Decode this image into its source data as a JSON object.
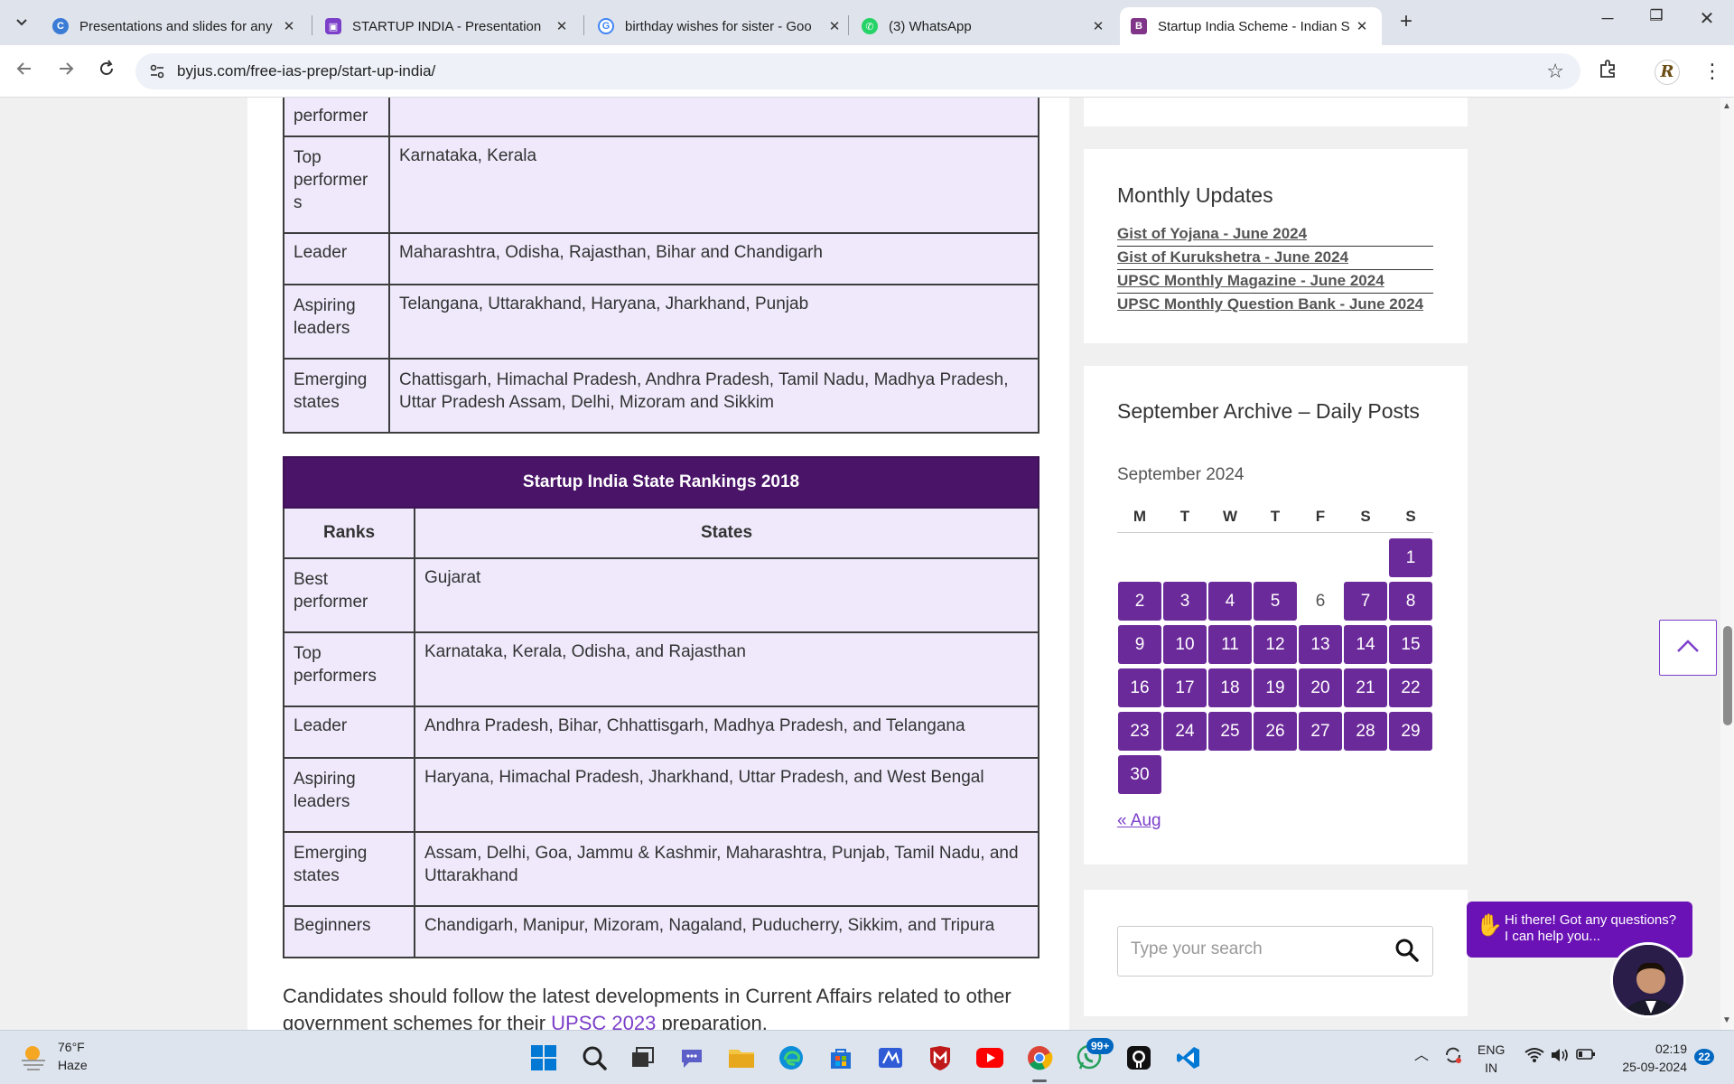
{
  "browser": {
    "tabs": [
      {
        "title": "Presentations and slides for any",
        "favicon": "canva-icon",
        "color": "#3a7bd5"
      },
      {
        "title": "STARTUP INDIA - Presentation",
        "favicon": "presentation-icon",
        "color": "#7b3fc9"
      },
      {
        "title": "birthday wishes for sister - Goo",
        "favicon": "google-icon",
        "color": "#4285f4"
      },
      {
        "title": "(3) WhatsApp",
        "favicon": "whatsapp-icon",
        "color": "#25d366"
      },
      {
        "title": "Startup India Scheme - Indian S",
        "favicon": "byjus-icon",
        "color": "#813588"
      }
    ],
    "url": "byjus.com/free-ias-prep/start-up-india/"
  },
  "table1": {
    "rows": [
      {
        "rank": "performer",
        "states": ""
      },
      {
        "rank": "Top performer s",
        "states": "Karnataka, Kerala"
      },
      {
        "rank": "Leader",
        "states": "Maharashtra, Odisha, Rajasthan, Bihar and Chandigarh"
      },
      {
        "rank": "Aspiring leaders",
        "states": "Telangana, Uttarakhand, Haryana, Jharkhand, Punjab"
      },
      {
        "rank": "Emerging states",
        "states": "Chattisgarh, Himachal Pradesh, Andhra Pradesh, Tamil Nadu, Madhya Pradesh, Uttar Pradesh Assam, Delhi, Mizoram and Sikkim"
      }
    ]
  },
  "table2": {
    "caption": "Startup India State Rankings 2018",
    "header_ranks": "Ranks",
    "header_states": "States",
    "rows": [
      {
        "rank": "Best performer",
        "states": "Gujarat"
      },
      {
        "rank": "Top performers",
        "states": "Karnataka, Kerala, Odisha, and Rajasthan"
      },
      {
        "rank": "Leader",
        "states": "Andhra Pradesh, Bihar, Chhattisgarh, Madhya Pradesh, and Telangana"
      },
      {
        "rank": "Aspiring leaders",
        "states": "Haryana, Himachal Pradesh, Jharkhand, Uttar Pradesh, and West Bengal"
      },
      {
        "rank": "Emerging states",
        "states": "Assam, Delhi, Goa, Jammu & Kashmir, Maharashtra, Punjab, Tamil Nadu, and Uttarakhand"
      },
      {
        "rank": "Beginners",
        "states": "Chandigarh, Manipur, Mizoram, Nagaland, Puducherry, Sikkim, and Tripura"
      }
    ]
  },
  "paragraph": {
    "before": "Candidates should follow the latest developments in Current Affairs related to other government schemes for their ",
    "link": "UPSC 2023",
    "after": " preparation."
  },
  "sidebar": {
    "updates_title": "Monthly Updates",
    "updates": [
      "Gist of Yojana - June 2024",
      "Gist of Kurukshetra - June 2024",
      "UPSC Monthly Magazine - June 2024",
      "UPSC Monthly Question Bank - June 2024"
    ],
    "archive_title": "September Archive – Daily Posts",
    "calendar_caption": "September 2024",
    "weekdays": [
      "M",
      "T",
      "W",
      "T",
      "F",
      "S",
      "S"
    ],
    "weeks": [
      [
        null,
        null,
        null,
        null,
        null,
        null,
        "1"
      ],
      [
        "2",
        "3",
        "4",
        "5",
        "6",
        "7",
        "8"
      ],
      [
        "9",
        "10",
        "11",
        "12",
        "13",
        "14",
        "15"
      ],
      [
        "16",
        "17",
        "18",
        "19",
        "20",
        "21",
        "22"
      ],
      [
        "23",
        "24",
        "25",
        "26",
        "27",
        "28",
        "29"
      ],
      [
        "30",
        null,
        null,
        null,
        null,
        null,
        null
      ]
    ],
    "unlinked_days": [
      "6"
    ],
    "prev_link": "« Aug",
    "search_placeholder": "Type your search"
  },
  "chat": {
    "message": "Hi there! Got any questions? I can help you..."
  },
  "taskbar": {
    "temperature": "76°F",
    "condition": "Haze",
    "whatsapp_badge": "99+",
    "language_line1": "ENG",
    "language_line2": "IN",
    "time": "02:19",
    "date": "25-09-2024",
    "notification_count": "22"
  },
  "colors": {
    "brand_purple": "#6b2a9a",
    "table_header": "#4a1468",
    "table_bg": "#efe9fb",
    "link": "#7b3fc9"
  }
}
